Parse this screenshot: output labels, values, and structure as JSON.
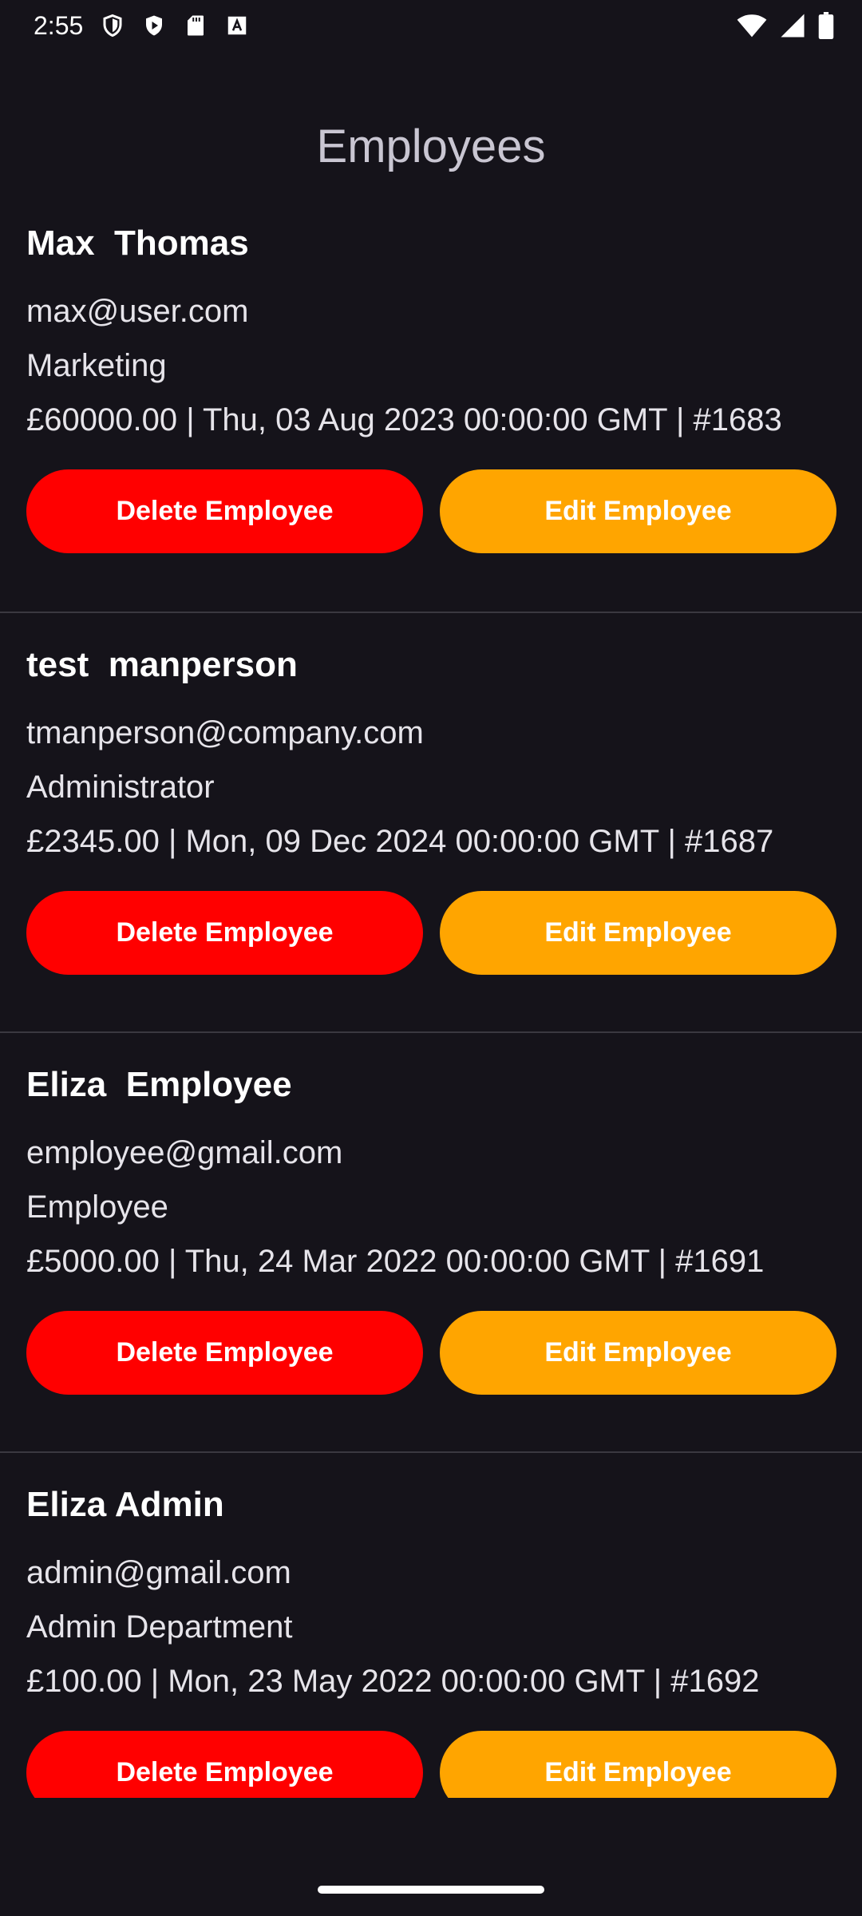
{
  "status_bar": {
    "time": "2:55",
    "left_icons": [
      "shield-icon",
      "play-protect-icon",
      "sd-card-icon",
      "font-a-icon"
    ],
    "right_icons": [
      "wifi-icon",
      "signal-icon",
      "battery-icon"
    ]
  },
  "app": {
    "title": "Employees"
  },
  "employees": [
    {
      "name": "Max  Thomas",
      "email": "max@user.com",
      "department": "Marketing",
      "meta": "£60000.00 | Thu, 03 Aug 2023 00:00:00 GMT | #1683",
      "delete_label": "Delete Employee",
      "edit_label": "Edit Employee"
    },
    {
      "name": "test  manperson",
      "email": "tmanperson@company.com",
      "department": "Administrator",
      "meta": "£2345.00 | Mon, 09 Dec 2024 00:00:00 GMT | #1687",
      "delete_label": "Delete Employee",
      "edit_label": "Edit Employee"
    },
    {
      "name": "Eliza  Employee",
      "email": "employee@gmail.com",
      "department": "Employee",
      "meta": "£5000.00 | Thu, 24 Mar 2022 00:00:00 GMT | #1691",
      "delete_label": "Delete Employee",
      "edit_label": "Edit Employee"
    },
    {
      "name": "Eliza Admin",
      "email": "admin@gmail.com",
      "department": "Admin Department",
      "meta": "£100.00 | Mon, 23 May 2022 00:00:00 GMT | #1692",
      "delete_label": "Delete Employee",
      "edit_label": "Edit Employee"
    }
  ],
  "colors": {
    "background": "#15131a",
    "delete": "#ff0000",
    "edit": "#ffa500",
    "title": "#c9c6d2"
  }
}
